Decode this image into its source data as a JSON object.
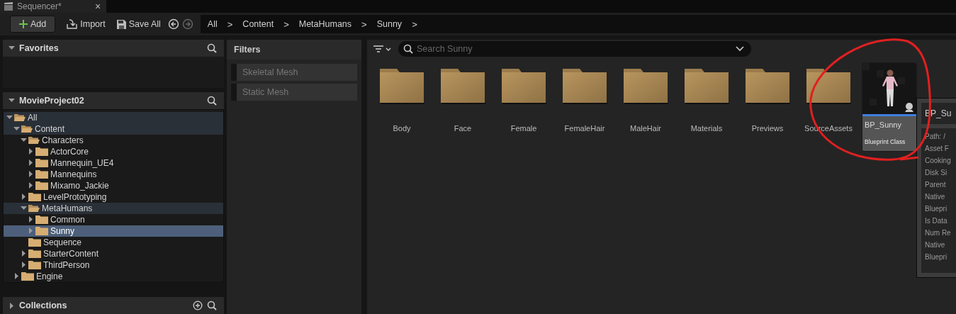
{
  "tab": {
    "title": "Sequencer*",
    "close": "×"
  },
  "toolbar": {
    "buttons": [
      {
        "kind": "add",
        "label": "Add"
      },
      {
        "kind": "import",
        "label": "Import"
      },
      {
        "kind": "save",
        "label": "Save All"
      }
    ],
    "breadcrumb": [
      {
        "label": "All"
      },
      {
        "label": "Content"
      },
      {
        "label": "MetaHumans"
      },
      {
        "label": "Sunny"
      }
    ],
    "separator": ">"
  },
  "favorites": {
    "title": "Favorites",
    "expanded": true
  },
  "project": {
    "title": "MovieProject02",
    "expanded": true,
    "tree": [
      {
        "label": "All",
        "expanded": true,
        "expandable": true,
        "highlighted": true,
        "selected": false,
        "children": [
          {
            "label": "Content",
            "expanded": true,
            "expandable": true,
            "highlighted": true,
            "selected": false,
            "children": [
              {
                "label": "Characters",
                "expanded": true,
                "expandable": true,
                "highlighted": false,
                "selected": false,
                "children": [
                  {
                    "label": "ActorCore",
                    "expanded": false,
                    "expandable": true,
                    "highlighted": false,
                    "selected": false
                  },
                  {
                    "label": "Mannequin_UE4",
                    "expanded": false,
                    "expandable": true,
                    "highlighted": false,
                    "selected": false
                  },
                  {
                    "label": "Mannequins",
                    "expanded": false,
                    "expandable": true,
                    "highlighted": false,
                    "selected": false
                  },
                  {
                    "label": "Mixamo_Jackie",
                    "expanded": false,
                    "expandable": true,
                    "highlighted": false,
                    "selected": false
                  }
                ]
              },
              {
                "label": "LevelPrototyping",
                "expanded": false,
                "expandable": true,
                "highlighted": false,
                "selected": false
              },
              {
                "label": "MetaHumans",
                "expanded": true,
                "expandable": true,
                "highlighted": true,
                "selected": false,
                "children": [
                  {
                    "label": "Common",
                    "expanded": false,
                    "expandable": true,
                    "highlighted": false,
                    "selected": false
                  },
                  {
                    "label": "Sunny",
                    "expanded": false,
                    "expandable": true,
                    "highlighted": false,
                    "selected": true
                  }
                ]
              },
              {
                "label": "Sequence",
                "expanded": false,
                "expandable": false,
                "highlighted": false,
                "selected": false
              },
              {
                "label": "StarterContent",
                "expanded": false,
                "expandable": true,
                "highlighted": false,
                "selected": false
              },
              {
                "label": "ThirdPerson",
                "expanded": false,
                "expandable": true,
                "highlighted": false,
                "selected": false
              }
            ]
          },
          {
            "label": "Engine",
            "expanded": false,
            "expandable": true,
            "highlighted": false,
            "selected": false
          }
        ]
      }
    ]
  },
  "collections": {
    "title": "Collections",
    "expanded": false
  },
  "filters": {
    "title": "Filters",
    "items": [
      {
        "label": "Skeletal Mesh",
        "checked": false
      },
      {
        "label": "Static Mesh",
        "checked": false
      }
    ]
  },
  "search": {
    "placeholder": "Search Sunny"
  },
  "assets": [
    {
      "kind": "folder",
      "name": "Body"
    },
    {
      "kind": "folder",
      "name": "Face"
    },
    {
      "kind": "folder",
      "name": "Female"
    },
    {
      "kind": "folder",
      "name": "FemaleHair"
    },
    {
      "kind": "folder",
      "name": "MaleHair"
    },
    {
      "kind": "folder",
      "name": "Materials"
    },
    {
      "kind": "folder",
      "name": "Previews"
    },
    {
      "kind": "folder",
      "name": "SourceAssets"
    },
    {
      "kind": "asset",
      "name": "BP_Sunny",
      "type": "Blueprint Class",
      "color": "#3d7fe0"
    }
  ],
  "tooltip": {
    "title": "BP_Su",
    "lines": [
      "Path: /",
      "Asset F",
      "Cooking",
      "Disk Si",
      "Parent",
      "Native",
      "Bluepri",
      "Is Data",
      "Num Re",
      "Native",
      "Bluepri"
    ]
  }
}
